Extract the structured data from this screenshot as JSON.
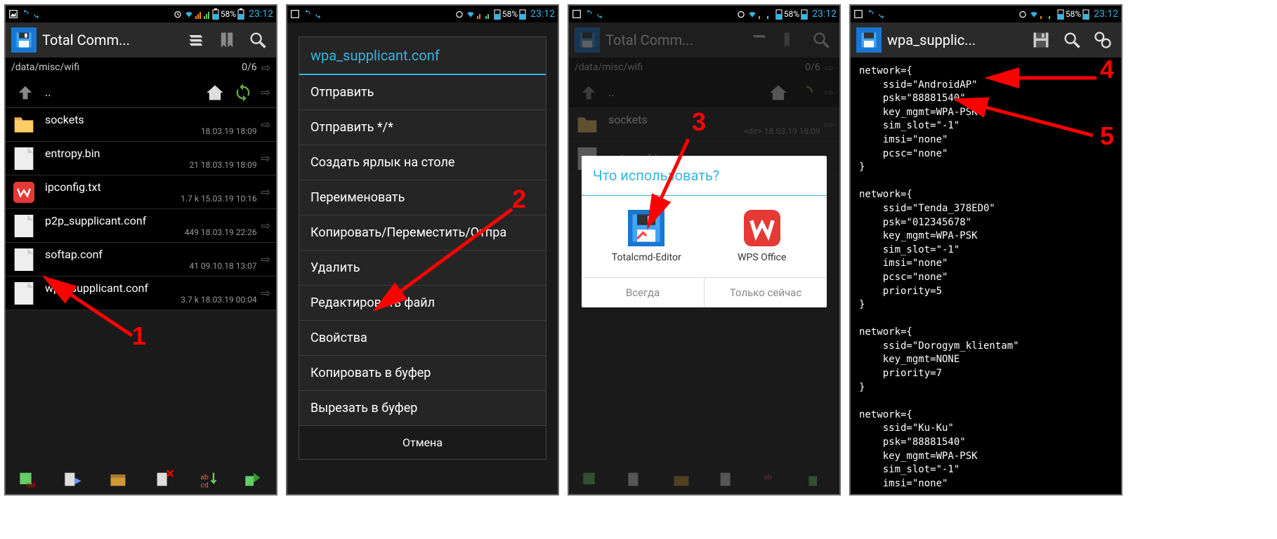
{
  "status": {
    "battery": "58%",
    "time": "23:12"
  },
  "screen1": {
    "title": "Total Comm...",
    "path": "/data/misc/wifi",
    "counter": "0/6",
    "parent": "..",
    "files": [
      {
        "name": "sockets",
        "meta": "<dir>  18.03.19  18:09",
        "type": "folder"
      },
      {
        "name": "entropy.bin",
        "meta": "21  18.03.19  18:09",
        "type": "file"
      },
      {
        "name": "ipconfig.txt",
        "meta": "1.7 k  15.03.19  10:16",
        "type": "wps"
      },
      {
        "name": "p2p_supplicant.conf",
        "meta": "449  18.03.19  22:26",
        "type": "file"
      },
      {
        "name": "softap.conf",
        "meta": "41  09.10.18  13:07",
        "type": "file"
      },
      {
        "name": "wpa_supplicant.conf",
        "meta": "3.7 k  18.03.19  00:04",
        "type": "file"
      }
    ],
    "annotation": "1"
  },
  "screen2": {
    "menu_title": "wpa_supplicant.conf",
    "items": [
      "Отправить",
      "Отправить */*",
      "Создать ярлык на столе",
      "Переименовать",
      "Копировать/Переместить/Отпра",
      "Удалить",
      "Редактировать файл",
      "Свойства",
      "Копировать в буфер",
      "Вырезать в буфер"
    ],
    "cancel": "Отмена",
    "annotation": "2"
  },
  "screen3": {
    "title": "Total Comm...",
    "path": "/data/misc/wifi",
    "counter": "0/6",
    "chooser_title": "Что использовать?",
    "app1": "Totalcmd-Editor",
    "app2": "WPS Office",
    "always": "Всегда",
    "once": "Только сейчас",
    "annotation": "3"
  },
  "screen4": {
    "title": "wpa_supplic...",
    "content": "network={\n    ssid=\"AndroidAP\"\n    psk=\"88881540\"\n    key_mgmt=WPA-PSK\n    sim_slot=\"-1\"\n    imsi=\"none\"\n    pcsc=\"none\"\n}\n\nnetwork={\n    ssid=\"Tenda_378ED0\"\n    psk=\"012345678\"\n    key_mgmt=WPA-PSK\n    sim_slot=\"-1\"\n    imsi=\"none\"\n    pcsc=\"none\"\n    priority=5\n}\n\nnetwork={\n    ssid=\"Dorogym_klientam\"\n    key_mgmt=NONE\n    priority=7\n}\n\nnetwork={\n    ssid=\"Ku-Ku\"\n    psk=\"88881540\"\n    key_mgmt=WPA-PSK\n    sim_slot=\"-1\"\n    imsi=\"none\"",
    "annotation4": "4",
    "annotation5": "5"
  }
}
